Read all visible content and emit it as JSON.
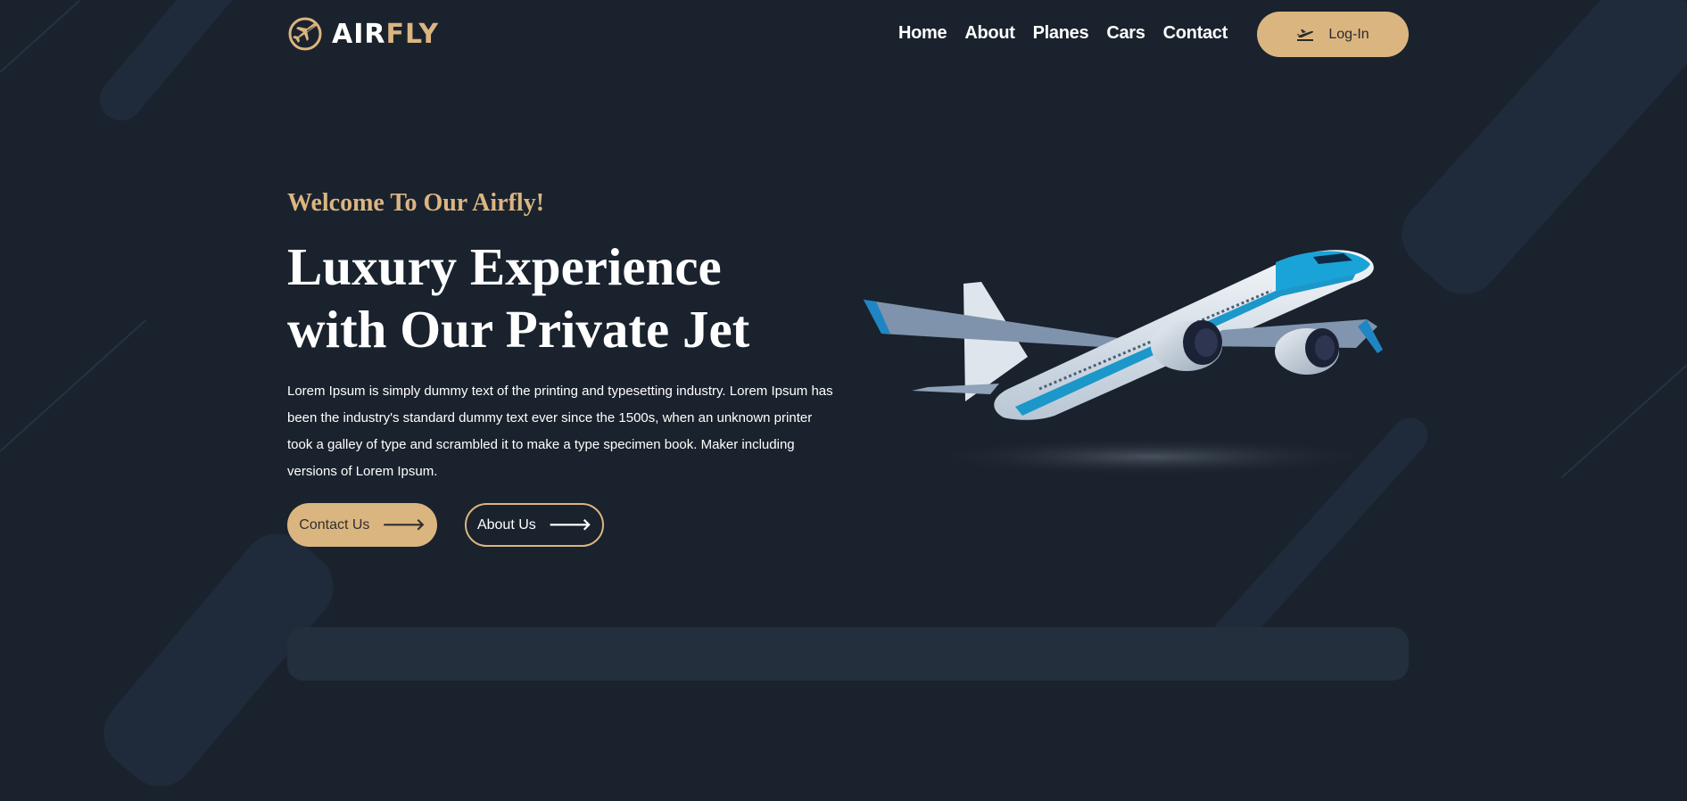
{
  "brand": {
    "name_part1": "AIR",
    "name_part2": "FLY"
  },
  "nav": {
    "items": [
      {
        "label": "Home"
      },
      {
        "label": "About"
      },
      {
        "label": "Planes"
      },
      {
        "label": "Cars"
      },
      {
        "label": "Contact"
      }
    ]
  },
  "header": {
    "login_label": "Log-In",
    "login_icon": "airplane-takeoff-icon"
  },
  "hero": {
    "eyebrow": "Welcome To Our Airfly!",
    "headline_line1": "Luxury Experience",
    "headline_line2": "with Our Private Jet",
    "body": "Lorem Ipsum is simply dummy text of the printing and typesetting industry. Lorem Ipsum has been the industry's standard dummy text ever since the 1500s, when an unknown printer took a galley of type and scrambled it to make a type specimen book. Maker including versions of Lorem Ipsum.",
    "contact_button": "Contact Us",
    "about_button": "About Us",
    "arrow_glyph": "🡒"
  },
  "colors": {
    "background": "#1a222d",
    "accent": "#dbb580",
    "text": "#ffffff"
  }
}
